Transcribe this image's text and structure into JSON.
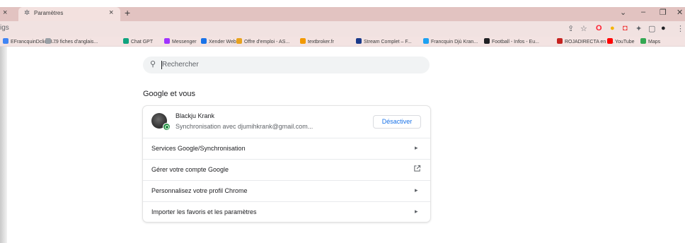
{
  "browser": {
    "tab_title": "Paramètres",
    "url_fragment": "igs",
    "new_tab_glyph": "+",
    "close_glyph": "×"
  },
  "bookmarks": [
    {
      "label": "EFrancquinDclic23...",
      "icon": "page-icon",
      "color": "#4285f4"
    },
    {
      "label": "79 fiches d'anglais...",
      "icon": "doc-icon",
      "color": "#9aa0a6"
    },
    {
      "label": "Chat GPT",
      "icon": "chatgpt-icon",
      "color": "#10a37f"
    },
    {
      "label": "Messenger",
      "icon": "messenger-icon",
      "color": "#a033ff"
    },
    {
      "label": "Xender Web",
      "icon": "xender-icon",
      "color": "#1a73e8"
    },
    {
      "label": "Offre d'emploi - AS...",
      "icon": "job-icon",
      "color": "#e8a21e"
    },
    {
      "label": "textbroker.fr",
      "icon": "textbroker-icon",
      "color": "#f29900"
    },
    {
      "label": "Stream Complet – F...",
      "icon": "stream-icon",
      "color": "#1a3a8a"
    },
    {
      "label": "Francquin Djù Kran...",
      "icon": "twitter-icon",
      "color": "#1da1f2"
    },
    {
      "label": "Football - Infos - Eu...",
      "icon": "football-icon",
      "color": "#202124"
    },
    {
      "label": "ROJADIRECTA en a...",
      "icon": "rojadirecta-icon",
      "color": "#c5221f"
    },
    {
      "label": "YouTube",
      "icon": "youtube-icon",
      "color": "#ff0000"
    },
    {
      "label": "Maps",
      "icon": "maps-icon",
      "color": "#34a853"
    }
  ],
  "search": {
    "placeholder": "Rechercher"
  },
  "section": {
    "title": "Google et vous"
  },
  "account": {
    "name": "Blackju Krank",
    "sync_text": "Synchronisation avec djumihkrank@gmail.com...",
    "button_label": "Désactiver"
  },
  "rows": [
    {
      "label": "Services Google/Synchronisation",
      "trailing": "arrow"
    },
    {
      "label": "Gérer votre compte Google",
      "trailing": "external"
    },
    {
      "label": "Personnalisez votre profil Chrome",
      "trailing": "arrow"
    },
    {
      "label": "Importer les favoris et les paramètres",
      "trailing": "arrow"
    }
  ],
  "colors": {
    "accent": "#1a73e8",
    "tabstrip": "#e2c3c1",
    "sync_green": "#1e8e3e"
  }
}
